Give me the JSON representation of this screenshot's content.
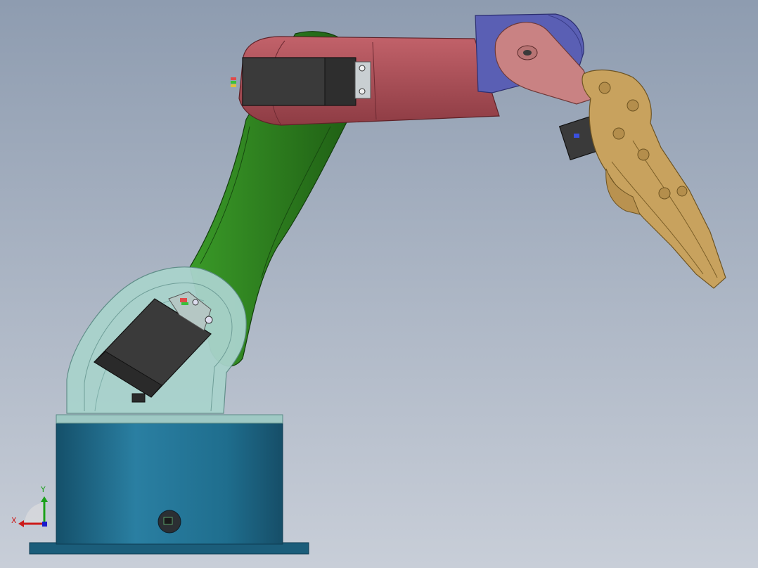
{
  "scene": {
    "background_top": "#8e9cb0",
    "background_bottom": "#c8ced8"
  },
  "model": {
    "parts": [
      {
        "name": "base-cylinder",
        "color": "#1f6e8e"
      },
      {
        "name": "shoulder-bracket",
        "color": "#a9d3cc"
      },
      {
        "name": "upper-arm",
        "color": "#2e7d1e"
      },
      {
        "name": "forearm",
        "color": "#b24e58"
      },
      {
        "name": "wrist-bracket",
        "color": "#5a5fb4"
      },
      {
        "name": "gripper",
        "color": "#c8a25e"
      },
      {
        "name": "servo-motor",
        "color": "#3a3a3a"
      }
    ]
  },
  "triad": {
    "x_label": "X",
    "y_label": "Y",
    "x_color": "#cc1a1a",
    "y_color": "#1aa01a",
    "z_color": "#1a1acc"
  }
}
